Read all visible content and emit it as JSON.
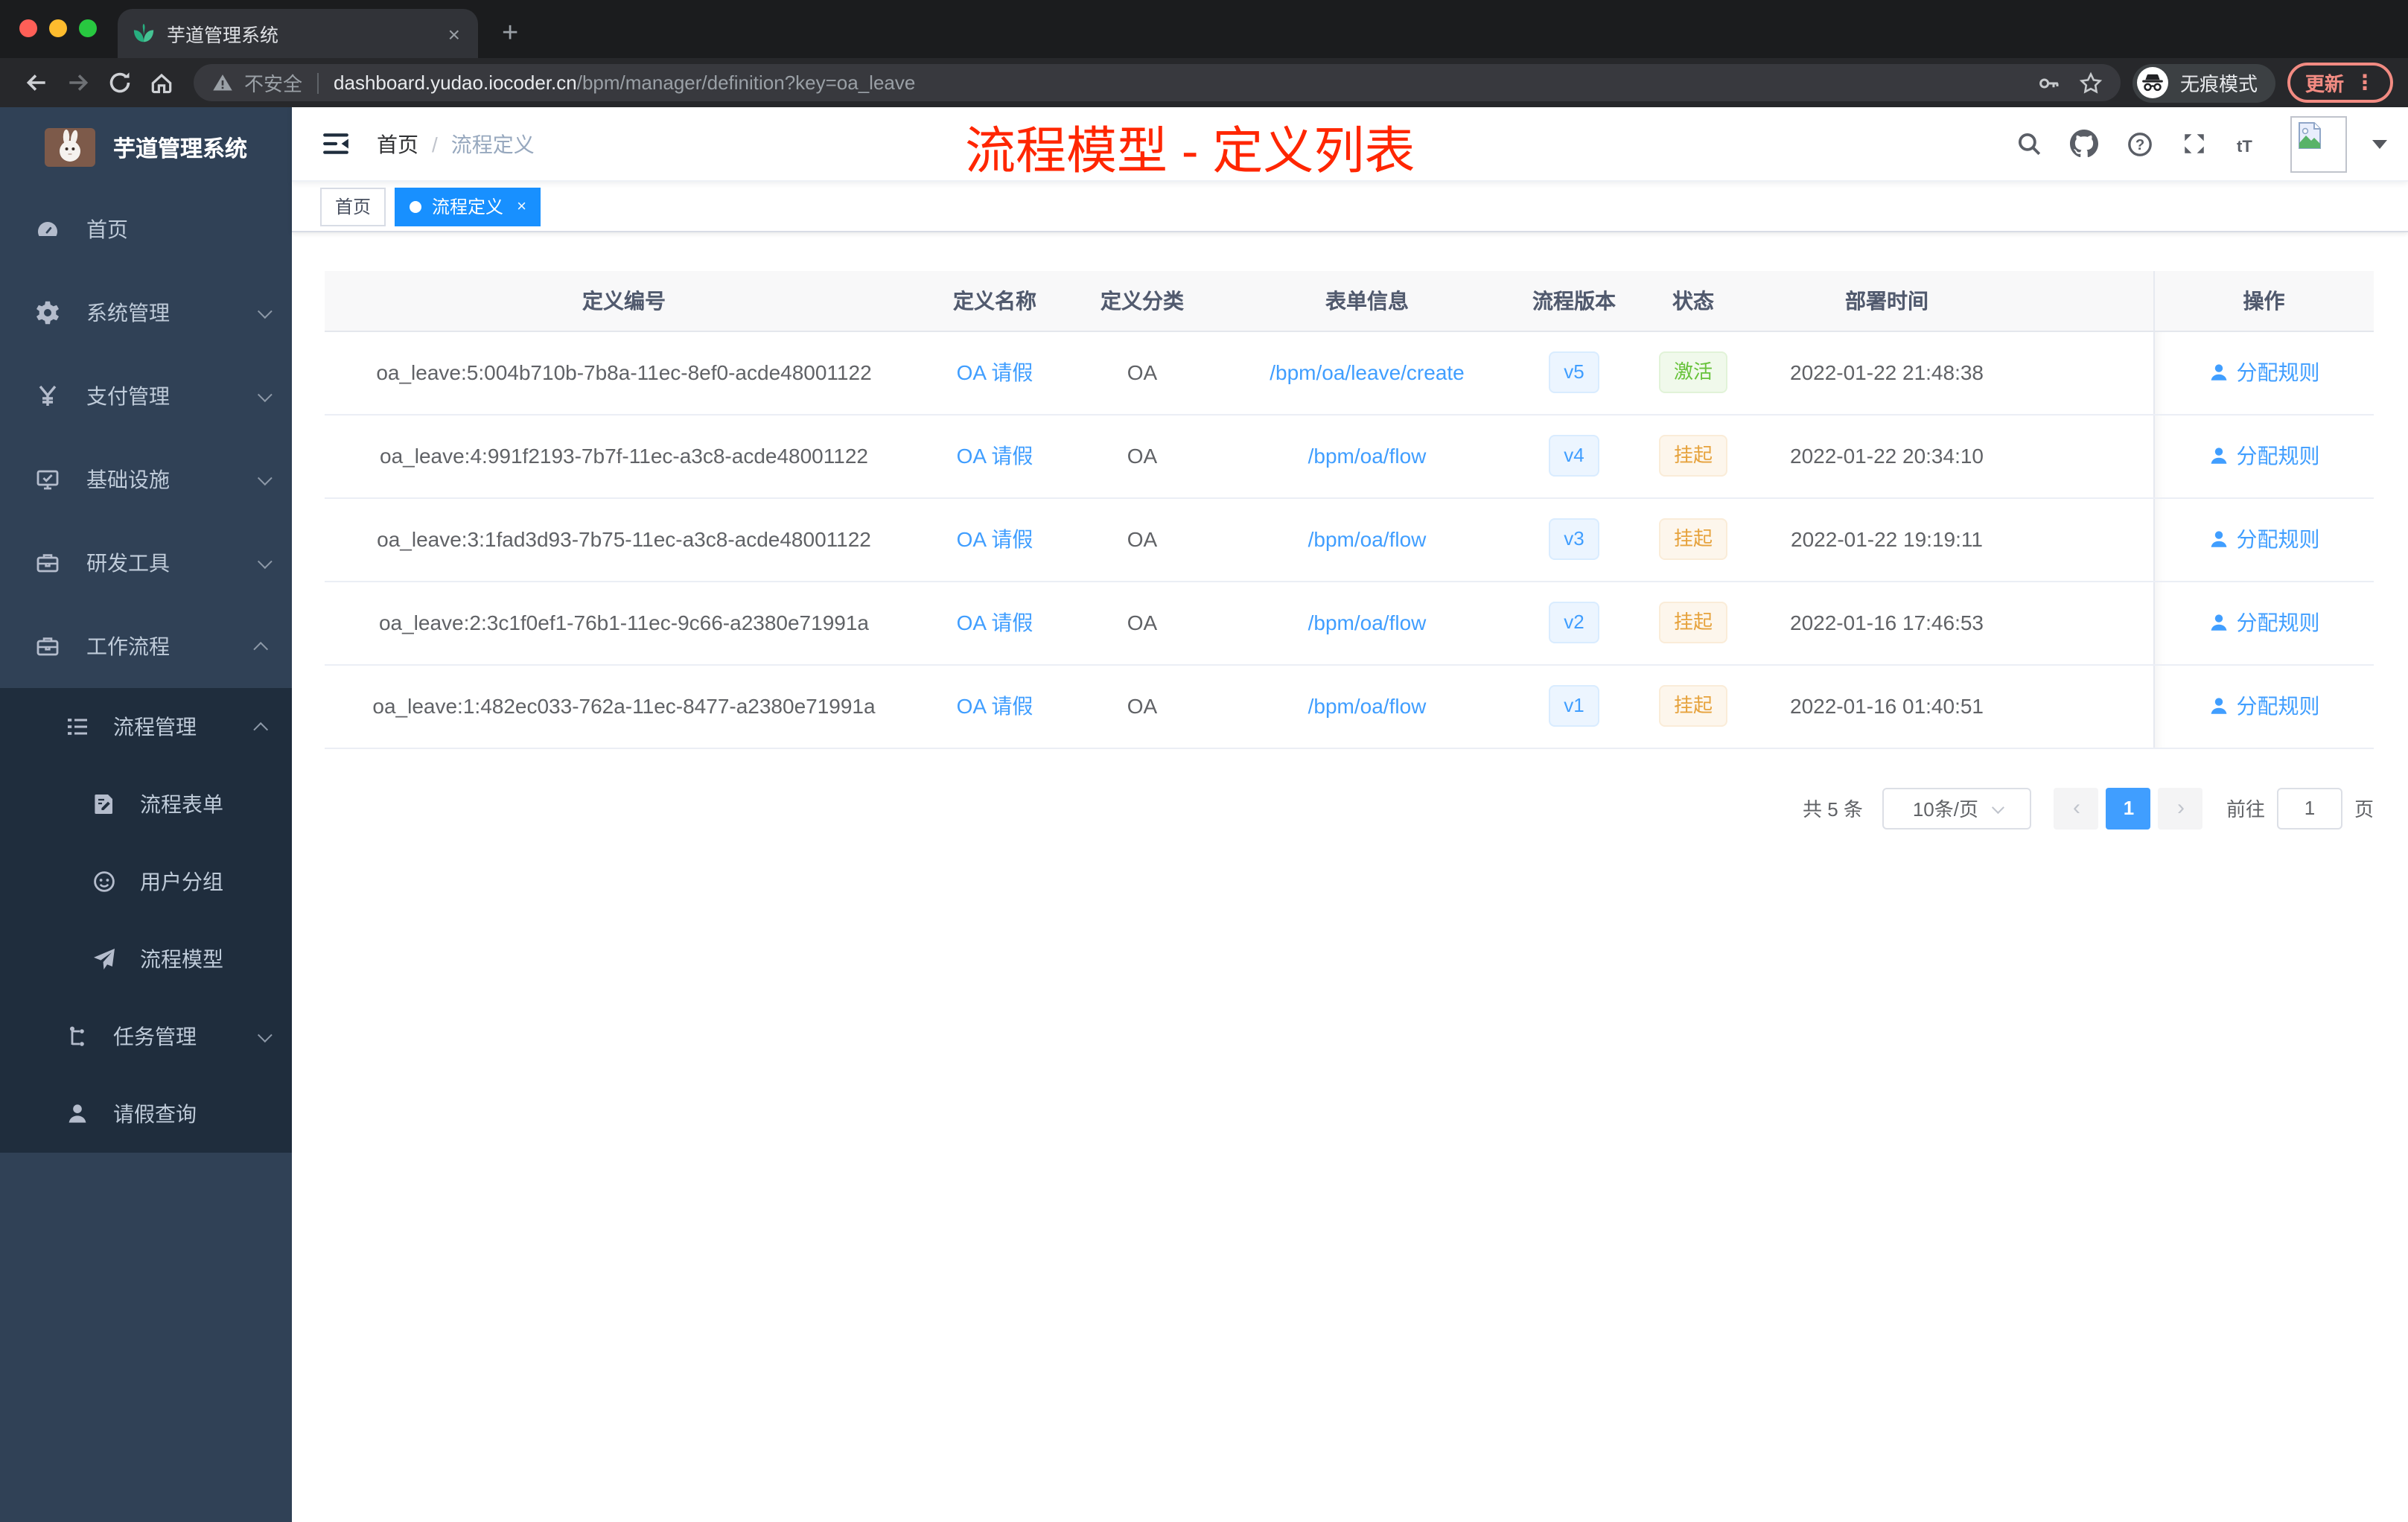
{
  "browser": {
    "tab_title": "芋道管理系统",
    "security_label": "不安全",
    "url_host": "dashboard.yudao.iocoder.cn",
    "url_path": "/bpm/manager/definition?key=oa_leave",
    "incognito_label": "无痕模式",
    "update_label": "更新"
  },
  "glyphs": {
    "close": "×",
    "new_tab": "+",
    "menu_dots": "⋮",
    "prev": "‹",
    "next": "›",
    "question_mark": "?",
    "font_size_icon": "tT"
  },
  "sidebar": {
    "app_title": "芋道管理系统",
    "menu": {
      "home": "首页",
      "system": "系统管理",
      "pay": "支付管理",
      "infra": "基础设施",
      "dev": "研发工具",
      "workflow": "工作流程",
      "process_mgmt": "流程管理",
      "process_form": "流程表单",
      "user_group": "用户分组",
      "process_model": "流程模型",
      "task_mgmt": "任务管理",
      "leave_query": "请假查询"
    }
  },
  "header": {
    "breadcrumb_home": "首页",
    "breadcrumb_separator": "/",
    "breadcrumb_current": "流程定义",
    "annotation": "流程模型 - 定义列表"
  },
  "tags": {
    "home_label": "首页",
    "active_label": "流程定义"
  },
  "table": {
    "columns": {
      "id": "定义编号",
      "name": "定义名称",
      "category": "定义分类",
      "form": "表单信息",
      "version": "流程版本",
      "status": "状态",
      "deploy_time": "部署时间",
      "actions": "操作"
    },
    "rows": [
      {
        "id": "oa_leave:5:004b710b-7b8a-11ec-8ef0-acde48001122",
        "name": "OA 请假",
        "category": "OA",
        "form": "/bpm/oa/leave/create",
        "version": "v5",
        "status": "激活",
        "time": "2022-01-22 21:48:38",
        "action": "分配规则"
      },
      {
        "id": "oa_leave:4:991f2193-7b7f-11ec-a3c8-acde48001122",
        "name": "OA 请假",
        "category": "OA",
        "form": "/bpm/oa/flow",
        "version": "v4",
        "status": "挂起",
        "time": "2022-01-22 20:34:10",
        "action": "分配规则"
      },
      {
        "id": "oa_leave:3:1fad3d93-7b75-11ec-a3c8-acde48001122",
        "name": "OA 请假",
        "category": "OA",
        "form": "/bpm/oa/flow",
        "version": "v3",
        "status": "挂起",
        "time": "2022-01-22 19:19:11",
        "action": "分配规则"
      },
      {
        "id": "oa_leave:2:3c1f0ef1-76b1-11ec-9c66-a2380e71991a",
        "name": "OA 请假",
        "category": "OA",
        "form": "/bpm/oa/flow",
        "version": "v2",
        "status": "挂起",
        "time": "2022-01-16 17:46:53",
        "action": "分配规则"
      },
      {
        "id": "oa_leave:1:482ec033-762a-11ec-8477-a2380e71991a",
        "name": "OA 请假",
        "category": "OA",
        "form": "/bpm/oa/flow",
        "version": "v1",
        "status": "挂起",
        "time": "2022-01-16 01:40:51",
        "action": "分配规则"
      }
    ]
  },
  "pagination": {
    "total_label": "共 5 条",
    "page_size_label": "10条/页",
    "current_page": "1",
    "goto_label": "前往",
    "goto_value": "1",
    "page_unit_label": "页"
  },
  "colors": {
    "accent_blue": "#409eff",
    "tag_active_blue": "#1890ff",
    "status_active_green": "#67c23a",
    "status_suspend_orange": "#e6a23c",
    "annotation_red": "#ff2600",
    "sidebar_bg": "#304156",
    "sidebar_submenu_bg": "#1f2d3d"
  }
}
